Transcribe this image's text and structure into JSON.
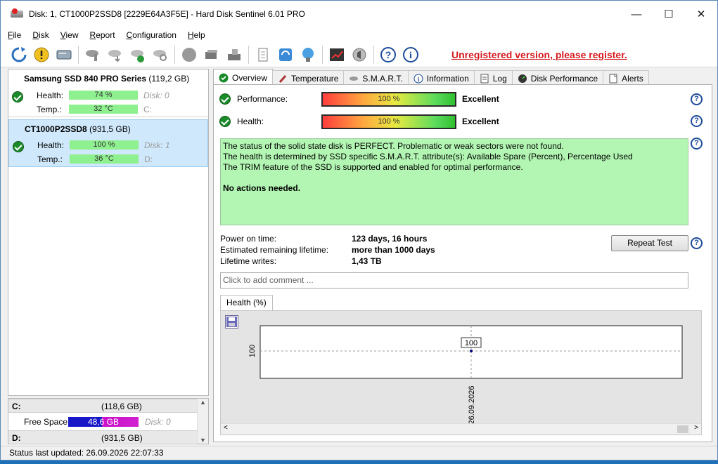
{
  "window": {
    "title": "Disk: 1, CT1000P2SSD8 [2229E64A3F5E]  -  Hard Disk Sentinel 6.01 PRO",
    "minimize": "—",
    "maximize": "☐",
    "close": "✕"
  },
  "menu": [
    {
      "u": "F",
      "rest": "ile"
    },
    {
      "u": "D",
      "rest": "isk"
    },
    {
      "u": "V",
      "rest": "iew"
    },
    {
      "u": "R",
      "rest": "eport"
    },
    {
      "u": "C",
      "rest": "onfiguration"
    },
    {
      "u": "H",
      "rest": "elp"
    }
  ],
  "toolbar": {
    "register_text": "Unregistered version, please register."
  },
  "disks": [
    {
      "name": "Samsung SSD 840 PRO Series",
      "size": "(119,2 GB)",
      "health_label": "Health:",
      "health": "74 %",
      "health_value": 74,
      "temp_label": "Temp.:",
      "temp": "32 °C",
      "disk_index": "Disk: 0",
      "drive": "C:"
    },
    {
      "name": "CT1000P2SSD8",
      "size": "(931,5 GB)",
      "health_label": "Health:",
      "health": "100 %",
      "health_value": 100,
      "temp_label": "Temp.:",
      "temp": "36 °C",
      "disk_index": "Disk: 1",
      "drive": "D:"
    }
  ],
  "volumes": {
    "c_letter": "C:",
    "c_size": "(118,6 GB)",
    "free_label": "Free Space",
    "free_value": "48,6 GB",
    "free_disk": "Disk: 0",
    "d_letter": "D:",
    "d_size": "(931,5 GB)"
  },
  "status": "Status last updated: 26.09.2026 22:07:33",
  "tabs": [
    "Overview",
    "Temperature",
    "S.M.A.R.T.",
    "Information",
    "Log",
    "Disk Performance",
    "Alerts"
  ],
  "overview": {
    "performance_label": "Performance:",
    "performance_value": "100 %",
    "performance_rating": "Excellent",
    "health_label": "Health:",
    "health_value": "100 %",
    "health_rating": "Excellent",
    "status_lines": [
      "The status of the solid state disk is PERFECT. Problematic or weak sectors were not found.",
      "The health is determined by SSD specific S.M.A.R.T. attribute(s):  Available Spare (Percent), Percentage Used",
      "The TRIM feature of the SSD is supported and enabled for optimal performance."
    ],
    "status_action": "No actions needed.",
    "power_on_label": "Power on time:",
    "power_on_value": "123 days, 16 hours",
    "lifetime_label": "Estimated remaining lifetime:",
    "lifetime_value": "more than 1000 days",
    "writes_label": "Lifetime writes:",
    "writes_value": "1,43 TB",
    "repeat_button": "Repeat Test",
    "comment_placeholder": "Click to add comment ...",
    "subtab": "Health (%)"
  },
  "chart_data": {
    "type": "line",
    "title": "",
    "xlabel": "",
    "ylabel": "",
    "x": [
      "26.09.2026"
    ],
    "series": [
      {
        "values": [
          100
        ]
      }
    ],
    "data_labels": [
      "100"
    ],
    "ytick": "100",
    "grid": true
  }
}
